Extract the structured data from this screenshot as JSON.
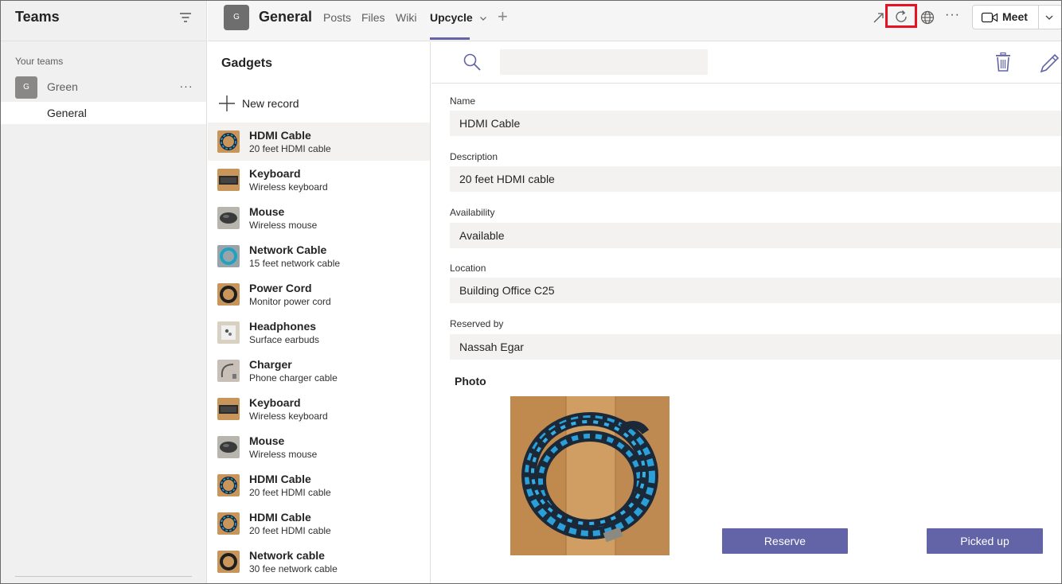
{
  "sidebar": {
    "title": "Teams",
    "section_label": "Your teams",
    "team": {
      "initial": "G",
      "name": "Green",
      "more": "···"
    },
    "channel": "General"
  },
  "header": {
    "channel_initial": "G",
    "channel_title": "General",
    "tabs": [
      {
        "label": "Posts",
        "active": false
      },
      {
        "label": "Files",
        "active": false
      },
      {
        "label": "Wiki",
        "active": false
      },
      {
        "label": "Upcycle",
        "active": true
      }
    ],
    "add_tab": "+",
    "more": "···",
    "meet_label": "Meet",
    "accent_color": "#6264a7",
    "highlight_color": "#e81123"
  },
  "list": {
    "title": "Gadgets",
    "new_record_label": "New record",
    "items": [
      {
        "title": "HDMI Cable",
        "subtitle": "20 feet HDMI cable",
        "thumb": "cable-blue"
      },
      {
        "title": "Keyboard",
        "subtitle": "Wireless keyboard",
        "thumb": "keyboard"
      },
      {
        "title": "Mouse",
        "subtitle": "Wireless mouse",
        "thumb": "mouse"
      },
      {
        "title": "Network Cable",
        "subtitle": "15 feet network cable",
        "thumb": "cable-teal"
      },
      {
        "title": "Power Cord",
        "subtitle": "Monitor power cord",
        "thumb": "cable-black"
      },
      {
        "title": "Headphones",
        "subtitle": "Surface earbuds",
        "thumb": "earbuds"
      },
      {
        "title": "Charger",
        "subtitle": "Phone charger cable",
        "thumb": "charger"
      },
      {
        "title": "Keyboard",
        "subtitle": "Wireless keyboard",
        "thumb": "keyboard"
      },
      {
        "title": "Mouse",
        "subtitle": "Wireless mouse",
        "thumb": "mouse"
      },
      {
        "title": "HDMI Cable",
        "subtitle": "20 feet HDMI cable",
        "thumb": "cable-blue"
      },
      {
        "title": "HDMI Cable",
        "subtitle": "20 feet HDMI cable",
        "thumb": "cable-blue"
      },
      {
        "title": "Network cable",
        "subtitle": "30 fee network cable",
        "thumb": "cable-black"
      }
    ]
  },
  "detail": {
    "search_placeholder": "",
    "fields": [
      {
        "label": "Name",
        "value": "HDMI Cable"
      },
      {
        "label": "Description",
        "value": "20 feet HDMI cable"
      },
      {
        "label": "Availability",
        "value": "Available"
      },
      {
        "label": "Location",
        "value": "Building Office C25"
      },
      {
        "label": "Reserved by",
        "value": "Nassah Egar"
      }
    ],
    "photo_label": "Photo",
    "reserve_label": "Reserve",
    "picked_up_label": "Picked up"
  }
}
